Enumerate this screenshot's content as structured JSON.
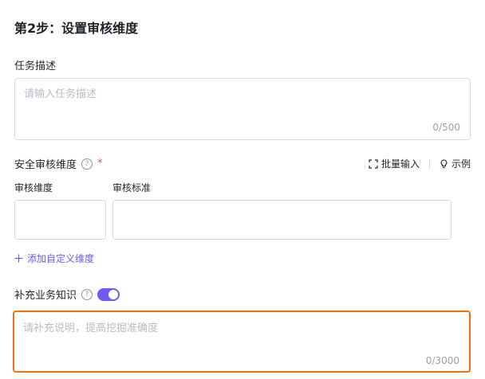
{
  "step": {
    "title": "第2步：设置审核维度"
  },
  "task": {
    "label": "任务描述",
    "placeholder": "请输入任务描述",
    "counter": "0/500"
  },
  "safety": {
    "label": "安全审核维度",
    "help_icon": "question-circle-icon",
    "required_mark": "*",
    "batch_input_label": "批量输入",
    "batch_icon": "expand-icon",
    "example_label": "示例",
    "example_icon": "bulb-icon"
  },
  "columns": {
    "dimension": "审核维度",
    "standard": "审核标准"
  },
  "add_custom": {
    "icon": "plus-icon",
    "label": "添加自定义维度"
  },
  "supplement": {
    "label": "补充业务知识",
    "help_icon": "question-circle-icon",
    "toggle_on": true,
    "placeholder": "请补充说明，提高挖掘准确度",
    "counter": "0/3000"
  },
  "colors": {
    "accent": "#6b5cf6",
    "focus_border": "#f0700d",
    "required": "#e34d59"
  }
}
